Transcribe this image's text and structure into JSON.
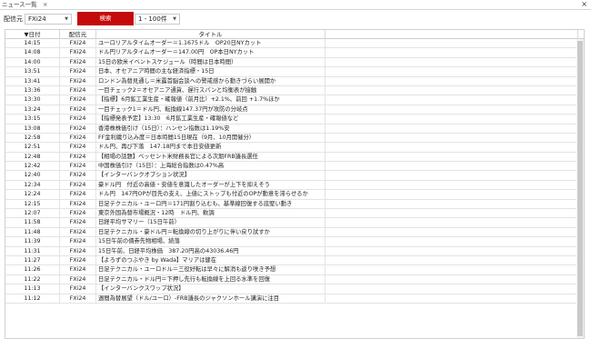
{
  "window": {
    "tab_label": "ニュース一覧",
    "tab_close": "×",
    "win_close": "×"
  },
  "toolbar": {
    "source_label": "配信元",
    "source_value": "FXi24",
    "search_label": "検索",
    "range_value": "1 - 100件"
  },
  "table": {
    "columns": [
      "▼日付",
      "配信元",
      "タイトル"
    ],
    "rows": [
      {
        "time": "14:15",
        "source": "FXi24",
        "title": "ユーロリアルタイムオーダー＝1.1675ドル　OP20日NYカット"
      },
      {
        "time": "14:08",
        "source": "FXi24",
        "title": "ドル円リアルタイムオーダー＝147.00円　OP本日NYカット"
      },
      {
        "time": "14:00",
        "source": "FXi24",
        "title": "15日の欧米イベントスケジュール（時間は日本時間）"
      },
      {
        "time": "13:51",
        "source": "FXi24",
        "title": "日本、オセアニア時間の主な経済指標・15日"
      },
      {
        "time": "13:41",
        "source": "FXi24",
        "title": "ロンドン為替見通し＝米露首脳会談への警戒感から動きづらい展開か"
      },
      {
        "time": "13:36",
        "source": "FXi24",
        "title": "一目チェック2＝オセアニア通貨、遅行スパンと均衡表が接触"
      },
      {
        "time": "13:30",
        "source": "FXi24",
        "title": "【指標】6月鉱工業生産・確報値（前月比）+2.1%、前回 +1.7%ほか"
      },
      {
        "time": "13:24",
        "source": "FXi24",
        "title": "一目チェック1＝ドル円、転換線147.37円が攻防の分岐点"
      },
      {
        "time": "13:15",
        "source": "FXi24",
        "title": "【指標発表予定】13:30　6月鉱工業生産・確報値など"
      },
      {
        "time": "13:08",
        "source": "FXi24",
        "title": "香港株株価引け（15日）：ハンセン指数は1.19%安"
      },
      {
        "time": "12:58",
        "source": "FXi24",
        "title": "FF金利織り込み度＝日本時間15日現在（9月、10月開催分）"
      },
      {
        "time": "12:51",
        "source": "FXi24",
        "title": "ドル円、再び下落　147.18円まで本日安値更新"
      },
      {
        "time": "12:48",
        "source": "FXi24",
        "title": "【相場の話題】ベッセント米財務長官による次期FRB議長選任"
      },
      {
        "time": "12:42",
        "source": "FXi24",
        "title": "中国株価引け（15日）：上海総合指数は0.47%高"
      },
      {
        "time": "12:40",
        "source": "FXi24",
        "title": "【インターバンクオプション状況】"
      },
      {
        "time": "12:34",
        "source": "FXi24",
        "title": "豪ドル円　付近の高値・安値を意識したオーダーが上下を抑えそう"
      },
      {
        "time": "12:24",
        "source": "FXi24",
        "title": "ドル円　147円OPが目先の支え、上値にストップも付近のOPが動意を滞らせるか"
      },
      {
        "time": "12:15",
        "source": "FXi24",
        "title": "日足テクニカル・ユーロ円＝171円割り込むも、基準線回復する底堅い動き"
      },
      {
        "time": "12:07",
        "source": "FXi24",
        "title": "東京外国為替市場概況・12時　ドル円、軟調"
      },
      {
        "time": "11:58",
        "source": "FXi24",
        "title": "日経平均サマリー（15日午前）"
      },
      {
        "time": "11:48",
        "source": "FXi24",
        "title": "日足テクニカル・豪ドル円＝転換線の切り上がりに伴い戻り試すか"
      },
      {
        "time": "11:39",
        "source": "FXi24",
        "title": "15日午前の債券先物相場、続落"
      },
      {
        "time": "11:31",
        "source": "FXi24",
        "title": "15日午前、日経平均株価　387.20円高の43036.46円"
      },
      {
        "time": "11:27",
        "source": "FXi24",
        "title": "【よろずのつぶやき by Wada】マリアは健在"
      },
      {
        "time": "11:26",
        "source": "FXi24",
        "title": "日足テクニカル・ユーロドル＝三役好転は早々に解消も返り咲き予想"
      },
      {
        "time": "11:22",
        "source": "FXi24",
        "title": "日足テクニカル・ドル円＝下押し先行も転換線を上回る水準を回復"
      },
      {
        "time": "11:13",
        "source": "FXi24",
        "title": "【インターバンクスワップ状況】"
      },
      {
        "time": "11:12",
        "source": "FXi24",
        "title": "週間為替展望（ドル/ユーロ）-FRB議長のジャクソンホール講演に注目"
      }
    ]
  }
}
